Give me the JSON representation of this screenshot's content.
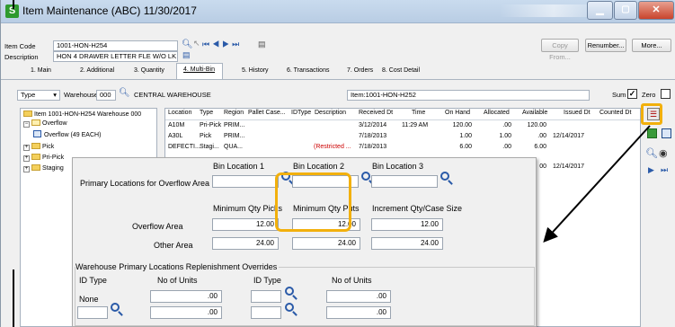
{
  "window": {
    "title": "Item Maintenance (ABC) 11/30/2017",
    "logo": "S"
  },
  "header": {
    "item_code_label": "Item Code",
    "item_code_value": "1001-HON-H254",
    "description_label": "Description",
    "description_value": "HON 4 DRAWER LETTER FLE W/O LK",
    "copy_from": "Copy From...",
    "renumber": "Renumber...",
    "more": "More..."
  },
  "tabs": [
    "1. Main",
    "2. Additional",
    "3. Quantity",
    "4. Multi-Bin",
    "5. History",
    "6. Transactions",
    "7. Orders",
    "8. Cost Detail"
  ],
  "filter": {
    "type_label": "Type",
    "warehouse_label": "Warehouse",
    "warehouse_code": "000",
    "warehouse_name": "CENTRAL WAREHOUSE",
    "item_label": "Item:1001-HON-H252",
    "sum_label": "Sum",
    "zero_label": "Zero"
  },
  "tree": {
    "root": "Item 1001-HON-H254 Warehouse 000",
    "overflow": "Overflow",
    "overflow_child": "Overflow (49 EACH)",
    "pick": "Pick",
    "pri_pick": "Pri-Pick",
    "staging": "Staging"
  },
  "grid": {
    "columns": [
      "Location",
      "Type",
      "Region",
      "Pallet Case...",
      "IDType",
      "Description",
      "Received Dt",
      "Time",
      "On Hand",
      "Allocated",
      "Available",
      "Issued Dt",
      "Counted Dt"
    ],
    "rows": [
      {
        "location": "A10M",
        "type": "Pri-Pick",
        "region": "PRIM...",
        "description": "",
        "received": "3/12/2014",
        "time": "11:29 AM",
        "on_hand": "120.00",
        "allocated": ".00",
        "available": "120.00",
        "issued": ""
      },
      {
        "location": "A30L",
        "type": "Pick",
        "region": "PRIM...",
        "description": "",
        "received": "7/18/2013",
        "time": "",
        "on_hand": "1.00",
        "allocated": "1.00",
        "available": ".00",
        "issued": "12/14/2017"
      },
      {
        "location": "DEFECTI...",
        "type": "Stagi...",
        "region": "QUA...",
        "description": "(Restricted ...",
        "received": "7/18/2013",
        "time": "",
        "on_hand": "6.00",
        "allocated": ".00",
        "available": "6.00",
        "issued": ""
      },
      {
        "location": "",
        "type": "",
        "region": "",
        "description": "",
        "received": "",
        "time": "",
        "on_hand": "",
        "allocated": "",
        "available": "00",
        "issued": "12/14/2017"
      }
    ]
  },
  "popup": {
    "bin1": "Bin Location 1",
    "bin2": "Bin Location 2",
    "bin3": "Bin Location 3",
    "primary_label": "Primary Locations for Overflow Area",
    "min_qty_picks": "Minimum Qty Picks",
    "min_qty_puts": "Minimum Qty Puts",
    "increment": "Increment Qty/Case Size",
    "overflow_area": "Overflow Area",
    "other_area": "Other Area",
    "overflow_picks": "12.00",
    "overflow_puts": "12.00",
    "overflow_inc": "12.00",
    "other_picks": "24.00",
    "other_puts": "24.00",
    "other_inc": "24.00",
    "replenish_title": "Warehouse Primary Locations Replenishment Overrides",
    "id_type": "ID Type",
    "no_units": "No of Units",
    "id_type_value": "None",
    "units_1": ".00",
    "units_2": ".00",
    "units_3": ".00",
    "units_4": ".00"
  },
  "colors": {
    "highlight": "#f2b00c",
    "restricted": "#cc0000"
  }
}
